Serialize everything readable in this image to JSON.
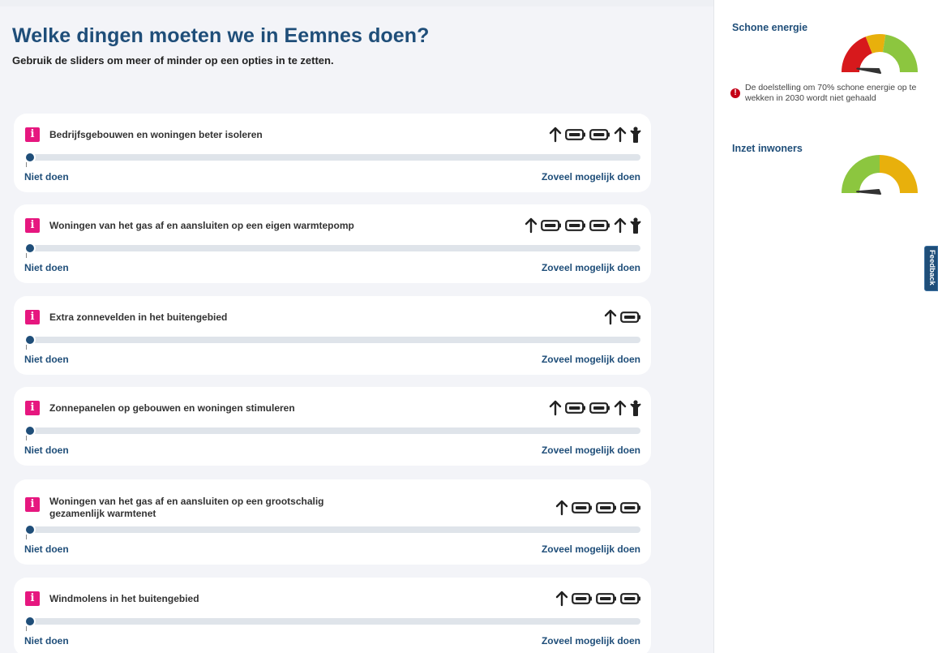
{
  "page": {
    "title": "Welke dingen moeten we in Eemnes doen?",
    "subtitle": "Gebruik de sliders om meer of minder op een opties in te zetten."
  },
  "slider_labels": {
    "min": "Niet doen",
    "max": "Zoveel mogelijk doen"
  },
  "options": [
    {
      "label": "Bedrijfsgebouwen en woningen beter isoleren",
      "value": 0,
      "impact": {
        "batteries": 2,
        "person": true
      }
    },
    {
      "label": "Woningen van het gas af en aansluiten op een eigen warmtepomp",
      "value": 0,
      "impact": {
        "batteries": 3,
        "person": true
      }
    },
    {
      "label": "Extra zonnevelden in het buitengebied",
      "value": 0,
      "impact": {
        "batteries": 1,
        "person": false
      }
    },
    {
      "label": "Zonnepanelen op gebouwen en woningen stimuleren",
      "value": 0,
      "impact": {
        "batteries": 2,
        "person": true
      }
    },
    {
      "label": "Woningen van het gas af en aansluiten op een grootschalig gezamenlijk warmtenet",
      "value": 0,
      "impact": {
        "batteries": 3,
        "person": false
      }
    },
    {
      "label": "Windmolens in het buitengebied",
      "value": 0,
      "impact": {
        "batteries": 3,
        "person": false
      }
    }
  ],
  "sidebar": {
    "schone_energie": {
      "title": "Schone energie",
      "gauge_level": 0.05,
      "gauge_colors": [
        "#d7191c",
        "#e8b00c",
        "#8cc63f"
      ],
      "warning": "De doelstelling om 70% schone energie op te wekken in 2030 wordt niet gehaald"
    },
    "inzet_inwoners": {
      "title": "Inzet inwoners",
      "gauge_level": 0.02,
      "gauge_colors": [
        "#8cc63f",
        "#e8b00c"
      ]
    }
  },
  "feedback": {
    "label": "Feedback"
  },
  "colors": {
    "title": "#1f4e79",
    "info": "#e6177f",
    "track": "#dfe4ea",
    "warning": "#c40016"
  },
  "icons": {
    "info": "info-icon",
    "impact_arrow": "arrow-up-icon",
    "impact_energy": "battery-icon",
    "impact_residents": "person-icon",
    "warning": "alert-circle-icon"
  }
}
